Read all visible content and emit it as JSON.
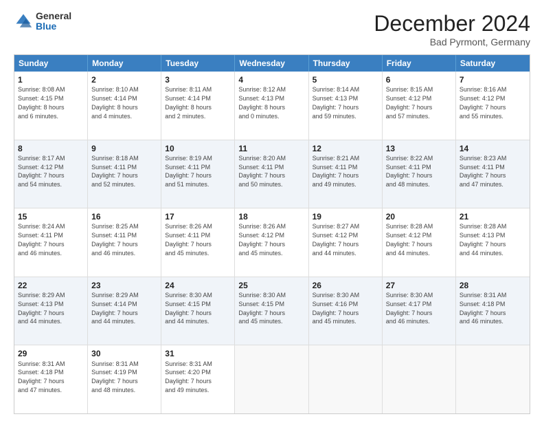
{
  "logo": {
    "general": "General",
    "blue": "Blue"
  },
  "title": "December 2024",
  "location": "Bad Pyrmont, Germany",
  "days_of_week": [
    "Sunday",
    "Monday",
    "Tuesday",
    "Wednesday",
    "Thursday",
    "Friday",
    "Saturday"
  ],
  "weeks": [
    [
      {
        "day": "1",
        "info": "Sunrise: 8:08 AM\nSunset: 4:15 PM\nDaylight: 8 hours\nand 6 minutes."
      },
      {
        "day": "2",
        "info": "Sunrise: 8:10 AM\nSunset: 4:14 PM\nDaylight: 8 hours\nand 4 minutes."
      },
      {
        "day": "3",
        "info": "Sunrise: 8:11 AM\nSunset: 4:14 PM\nDaylight: 8 hours\nand 2 minutes."
      },
      {
        "day": "4",
        "info": "Sunrise: 8:12 AM\nSunset: 4:13 PM\nDaylight: 8 hours\nand 0 minutes."
      },
      {
        "day": "5",
        "info": "Sunrise: 8:14 AM\nSunset: 4:13 PM\nDaylight: 7 hours\nand 59 minutes."
      },
      {
        "day": "6",
        "info": "Sunrise: 8:15 AM\nSunset: 4:12 PM\nDaylight: 7 hours\nand 57 minutes."
      },
      {
        "day": "7",
        "info": "Sunrise: 8:16 AM\nSunset: 4:12 PM\nDaylight: 7 hours\nand 55 minutes."
      }
    ],
    [
      {
        "day": "8",
        "info": "Sunrise: 8:17 AM\nSunset: 4:12 PM\nDaylight: 7 hours\nand 54 minutes."
      },
      {
        "day": "9",
        "info": "Sunrise: 8:18 AM\nSunset: 4:11 PM\nDaylight: 7 hours\nand 52 minutes."
      },
      {
        "day": "10",
        "info": "Sunrise: 8:19 AM\nSunset: 4:11 PM\nDaylight: 7 hours\nand 51 minutes."
      },
      {
        "day": "11",
        "info": "Sunrise: 8:20 AM\nSunset: 4:11 PM\nDaylight: 7 hours\nand 50 minutes."
      },
      {
        "day": "12",
        "info": "Sunrise: 8:21 AM\nSunset: 4:11 PM\nDaylight: 7 hours\nand 49 minutes."
      },
      {
        "day": "13",
        "info": "Sunrise: 8:22 AM\nSunset: 4:11 PM\nDaylight: 7 hours\nand 48 minutes."
      },
      {
        "day": "14",
        "info": "Sunrise: 8:23 AM\nSunset: 4:11 PM\nDaylight: 7 hours\nand 47 minutes."
      }
    ],
    [
      {
        "day": "15",
        "info": "Sunrise: 8:24 AM\nSunset: 4:11 PM\nDaylight: 7 hours\nand 46 minutes."
      },
      {
        "day": "16",
        "info": "Sunrise: 8:25 AM\nSunset: 4:11 PM\nDaylight: 7 hours\nand 46 minutes."
      },
      {
        "day": "17",
        "info": "Sunrise: 8:26 AM\nSunset: 4:11 PM\nDaylight: 7 hours\nand 45 minutes."
      },
      {
        "day": "18",
        "info": "Sunrise: 8:26 AM\nSunset: 4:12 PM\nDaylight: 7 hours\nand 45 minutes."
      },
      {
        "day": "19",
        "info": "Sunrise: 8:27 AM\nSunset: 4:12 PM\nDaylight: 7 hours\nand 44 minutes."
      },
      {
        "day": "20",
        "info": "Sunrise: 8:28 AM\nSunset: 4:12 PM\nDaylight: 7 hours\nand 44 minutes."
      },
      {
        "day": "21",
        "info": "Sunrise: 8:28 AM\nSunset: 4:13 PM\nDaylight: 7 hours\nand 44 minutes."
      }
    ],
    [
      {
        "day": "22",
        "info": "Sunrise: 8:29 AM\nSunset: 4:13 PM\nDaylight: 7 hours\nand 44 minutes."
      },
      {
        "day": "23",
        "info": "Sunrise: 8:29 AM\nSunset: 4:14 PM\nDaylight: 7 hours\nand 44 minutes."
      },
      {
        "day": "24",
        "info": "Sunrise: 8:30 AM\nSunset: 4:15 PM\nDaylight: 7 hours\nand 44 minutes."
      },
      {
        "day": "25",
        "info": "Sunrise: 8:30 AM\nSunset: 4:15 PM\nDaylight: 7 hours\nand 45 minutes."
      },
      {
        "day": "26",
        "info": "Sunrise: 8:30 AM\nSunset: 4:16 PM\nDaylight: 7 hours\nand 45 minutes."
      },
      {
        "day": "27",
        "info": "Sunrise: 8:30 AM\nSunset: 4:17 PM\nDaylight: 7 hours\nand 46 minutes."
      },
      {
        "day": "28",
        "info": "Sunrise: 8:31 AM\nSunset: 4:18 PM\nDaylight: 7 hours\nand 46 minutes."
      }
    ],
    [
      {
        "day": "29",
        "info": "Sunrise: 8:31 AM\nSunset: 4:18 PM\nDaylight: 7 hours\nand 47 minutes."
      },
      {
        "day": "30",
        "info": "Sunrise: 8:31 AM\nSunset: 4:19 PM\nDaylight: 7 hours\nand 48 minutes."
      },
      {
        "day": "31",
        "info": "Sunrise: 8:31 AM\nSunset: 4:20 PM\nDaylight: 7 hours\nand 49 minutes."
      },
      {
        "day": "",
        "info": ""
      },
      {
        "day": "",
        "info": ""
      },
      {
        "day": "",
        "info": ""
      },
      {
        "day": "",
        "info": ""
      }
    ]
  ]
}
